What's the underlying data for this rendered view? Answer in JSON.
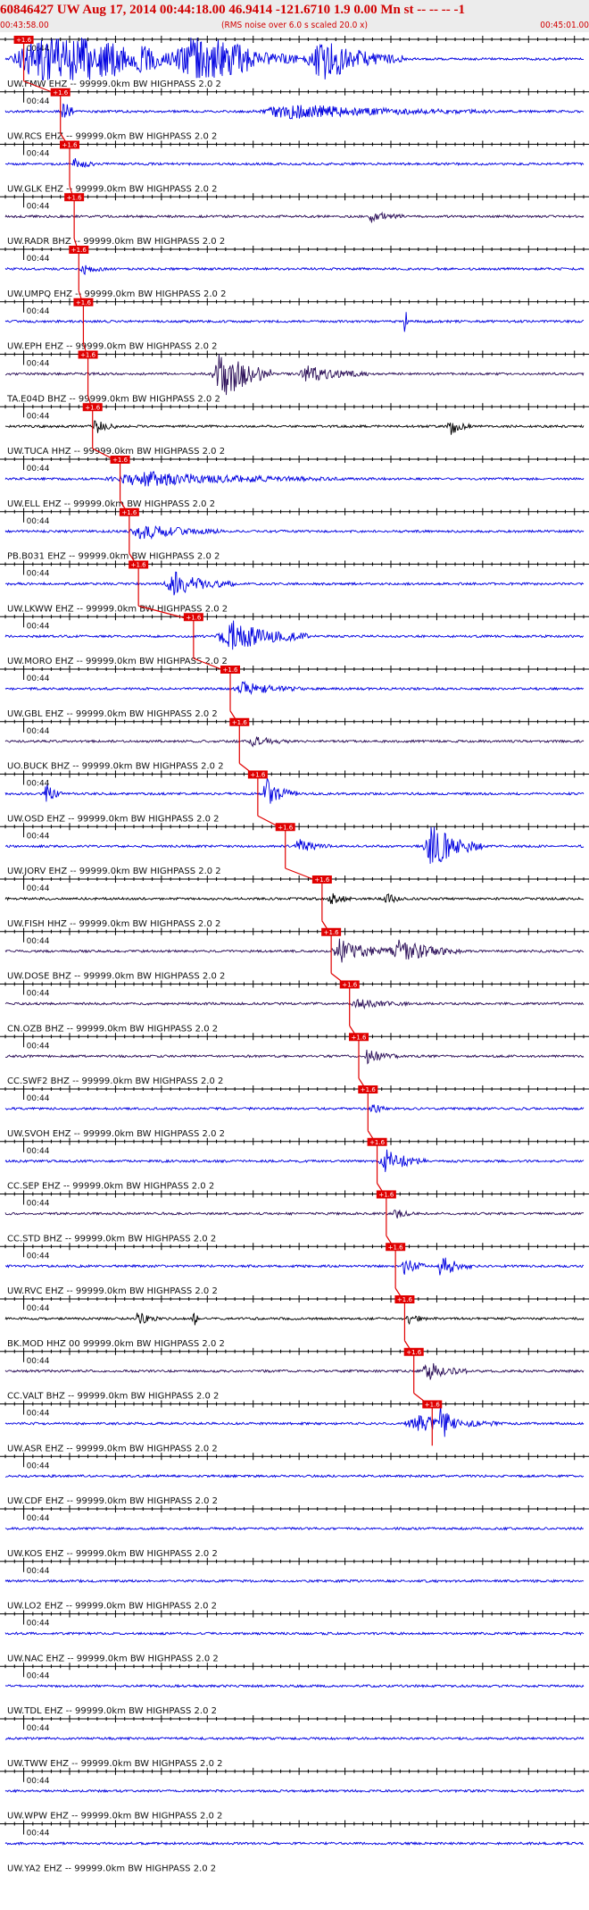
{
  "header": {
    "title": "60846427 UW Aug 17, 2014 00:44:18.00   46.9414 -121.6710  1.9 0.00 Mn st -- -- -- -1",
    "start_time": "00:43:58.00",
    "end_time": "00:45:01.00",
    "subtitle": "(RMS noise over 6.0 s scaled 20.0 x)"
  },
  "colors": {
    "header_band": "#ececec",
    "header_text": "#d10000",
    "trace_blue": "#0000e0",
    "trace_dark": "#2a0d57",
    "trace_black": "#000000",
    "pick": "#e00000"
  },
  "chart_data": {
    "type": "line",
    "time_range": [
      "00:43:58.00",
      "00:45:01.00"
    ],
    "minute_label": "00:44",
    "pick_label": "+1.6",
    "traces": [
      {
        "label": "UW.FMW EHZ -- 99999.0km BW  HIGHPASS  2.0  2",
        "color": "blue",
        "pick_s": 2.0,
        "bursts": [
          [
            4.5,
            10,
            9
          ],
          [
            21,
            6,
            5
          ],
          [
            34.5,
            4,
            6
          ]
        ]
      },
      {
        "label": "UW.RCS EHZ -- 99999.0km BW  HIGHPASS  2.0  2",
        "color": "blue",
        "pick_s": 6.0,
        "bursts": [
          [
            6.3,
            0.5,
            6
          ],
          [
            31,
            10,
            1.8
          ]
        ]
      },
      {
        "label": "UW.GLK EHZ -- 99999.0km BW  HIGHPASS  2.0  2",
        "color": "blue",
        "pick_s": 7.0,
        "bursts": [
          [
            7.5,
            1.0,
            1.8
          ]
        ]
      },
      {
        "label": "UW.RADR BHZ -- 99999.0km BW  HIGHPASS  2.0  2",
        "color": "dark",
        "pick_s": 7.5,
        "bursts": [
          [
            40,
            1.5,
            1.5
          ]
        ]
      },
      {
        "label": "UW.UMPQ EHZ -- 99999.0km BW  HIGHPASS  2.0  2",
        "color": "blue",
        "pick_s": 8.0,
        "bursts": [
          [
            8.5,
            1.0,
            1.6
          ]
        ]
      },
      {
        "label": "UW.EPH EHZ -- 99999.0km BW  HIGHPASS  2.0  2",
        "color": "blue",
        "pick_s": 8.5,
        "bursts": [
          [
            43.5,
            0.2,
            7
          ]
        ]
      },
      {
        "label": "TA.E04D BHZ -- 99999.0km BW  HIGHPASS  2.0  2",
        "color": "dark",
        "pick_s": 9.0,
        "bursts": [
          [
            23.5,
            2.5,
            8
          ],
          [
            33,
            3,
            2
          ]
        ]
      },
      {
        "label": "UW.TUCA HHZ -- 99999.0km BW  HIGHPASS  2.0  2",
        "color": "black",
        "pick_s": 9.5,
        "bursts": [
          [
            9.8,
            1.0,
            2
          ],
          [
            48.5,
            1.0,
            2.2
          ]
        ]
      },
      {
        "label": "UW.ELL EHZ -- 99999.0km BW  HIGHPASS  2.0  2",
        "color": "blue",
        "pick_s": 12.5,
        "bursts": [
          [
            15,
            10,
            1.8
          ]
        ]
      },
      {
        "label": "PB.B031 EHZ -- 99999.0km BW  HIGHPASS  2.0  2",
        "color": "blue",
        "pick_s": 13.5,
        "bursts": [
          [
            15,
            4,
            2
          ]
        ]
      },
      {
        "label": "UW.LKWW EHZ -- 99999.0km BW  HIGHPASS  2.0  2",
        "color": "blue",
        "pick_s": 14.5,
        "bursts": [
          [
            18.5,
            3,
            3
          ]
        ]
      },
      {
        "label": "UW.MORO EHZ -- 99999.0km BW  HIGHPASS  2.0  2",
        "color": "blue",
        "pick_s": 20.5,
        "bursts": [
          [
            24.5,
            4,
            4.5
          ]
        ]
      },
      {
        "label": "UW.GBL EHZ -- 99999.0km BW  HIGHPASS  2.0  2",
        "color": "blue",
        "pick_s": 24.5,
        "bursts": [
          [
            26,
            3,
            1.6
          ]
        ]
      },
      {
        "label": "UO.BUCK BHZ -- 99999.0km BW  HIGHPASS  2.0  2",
        "color": "dark",
        "pick_s": 25.5,
        "bursts": [
          [
            27,
            2,
            1.2
          ]
        ]
      },
      {
        "label": "UW.OSD EHZ -- 99999.0km BW  HIGHPASS  2.0  2",
        "color": "blue",
        "pick_s": 27.5,
        "bursts": [
          [
            4.5,
            0.8,
            2.5
          ],
          [
            28.5,
            1.5,
            4
          ]
        ]
      },
      {
        "label": "UW.JORV EHZ -- 99999.0km BW  HIGHPASS  2.0  2",
        "color": "blue",
        "pick_s": 30.5,
        "bursts": [
          [
            32,
            1.5,
            2
          ],
          [
            46.5,
            2.5,
            6
          ]
        ]
      },
      {
        "label": "UW.FISH HHZ -- 99999.0km BW  HIGHPASS  2.0  2",
        "color": "black",
        "pick_s": 34.5,
        "bursts": [
          [
            35.5,
            1.0,
            1.8
          ],
          [
            41.5,
            1.0,
            1.3
          ]
        ]
      },
      {
        "label": "UW.DOSE BHZ -- 99999.0km BW  HIGHPASS  2.0  2",
        "color": "dark",
        "pick_s": 35.5,
        "bursts": [
          [
            36.5,
            2.5,
            3.5
          ],
          [
            43,
            3,
            3
          ]
        ]
      },
      {
        "label": "CN.OZB BHZ -- 99999.0km BW  HIGHPASS  2.0  2",
        "color": "dark",
        "pick_s": 37.5,
        "bursts": [
          [
            38.5,
            2.5,
            1.2
          ]
        ]
      },
      {
        "label": "CC.SWF2 BHZ -- 99999.0km BW  HIGHPASS  2.0  2",
        "color": "dark",
        "pick_s": 38.5,
        "bursts": [
          [
            39.5,
            1.5,
            2
          ]
        ]
      },
      {
        "label": "UW.SVOH EHZ -- 99999.0km BW  HIGHPASS  2.0  2",
        "color": "blue",
        "pick_s": 39.5,
        "bursts": [
          [
            40,
            0.6,
            2
          ]
        ]
      },
      {
        "label": "CC.SEP EHZ -- 99999.0km BW  HIGHPASS  2.0  2",
        "color": "blue",
        "pick_s": 40.5,
        "bursts": [
          [
            41.5,
            2.0,
            3
          ]
        ]
      },
      {
        "label": "CC.STD BHZ -- 99999.0km BW  HIGHPASS  2.0  2",
        "color": "dark",
        "pick_s": 41.5,
        "bursts": [
          [
            42.5,
            1.0,
            1.2
          ]
        ]
      },
      {
        "label": "UW.RVC EHZ -- 99999.0km BW  HIGHPASS  2.0  2",
        "color": "blue",
        "pick_s": 42.5,
        "bursts": [
          [
            43.5,
            1.0,
            3
          ],
          [
            47.5,
            1.5,
            2.8
          ]
        ]
      },
      {
        "label": "BK.MOD HHZ 00 99999.0km BW  HIGHPASS  2.0  2",
        "color": "black",
        "pick_s": 43.5,
        "bursts": [
          [
            14.5,
            1.0,
            1.8
          ],
          [
            20.5,
            0.3,
            2.5
          ],
          [
            44,
            1.0,
            1.3
          ]
        ]
      },
      {
        "label": "CC.VALT BHZ -- 99999.0km BW  HIGHPASS  2.0  2",
        "color": "dark",
        "pick_s": 44.5,
        "bursts": [
          [
            46,
            2,
            2.5
          ]
        ]
      },
      {
        "label": "UW.ASR EHZ -- 99999.0km BW  HIGHPASS  2.0  2",
        "color": "blue",
        "pick_s": 46.5,
        "bursts": [
          [
            45,
            4,
            2.2
          ],
          [
            47.5,
            0.8,
            4
          ]
        ]
      },
      {
        "label": "UW.CDF EHZ -- 99999.0km BW  HIGHPASS  2.0  2",
        "color": "blue",
        "pick_s": null,
        "bursts": []
      },
      {
        "label": "UW.KOS EHZ -- 99999.0km BW  HIGHPASS  2.0  2",
        "color": "blue",
        "pick_s": null,
        "bursts": []
      },
      {
        "label": "UW.LO2 EHZ -- 99999.0km BW  HIGHPASS  2.0  2",
        "color": "blue",
        "pick_s": null,
        "bursts": []
      },
      {
        "label": "UW.NAC EHZ -- 99999.0km BW  HIGHPASS  2.0  2",
        "color": "blue",
        "pick_s": null,
        "bursts": []
      },
      {
        "label": "UW.TDL EHZ -- 99999.0km BW  HIGHPASS  2.0  2",
        "color": "blue",
        "pick_s": null,
        "bursts": []
      },
      {
        "label": "UW.TWW EHZ -- 99999.0km BW  HIGHPASS  2.0  2",
        "color": "blue",
        "pick_s": null,
        "bursts": []
      },
      {
        "label": "UW.WPW EHZ -- 99999.0km BW  HIGHPASS  2.0  2",
        "color": "blue",
        "pick_s": null,
        "bursts": []
      },
      {
        "label": "UW.YA2 EHZ -- 99999.0km BW  HIGHPASS  2.0  2",
        "color": "blue",
        "pick_s": null,
        "bursts": []
      }
    ]
  }
}
